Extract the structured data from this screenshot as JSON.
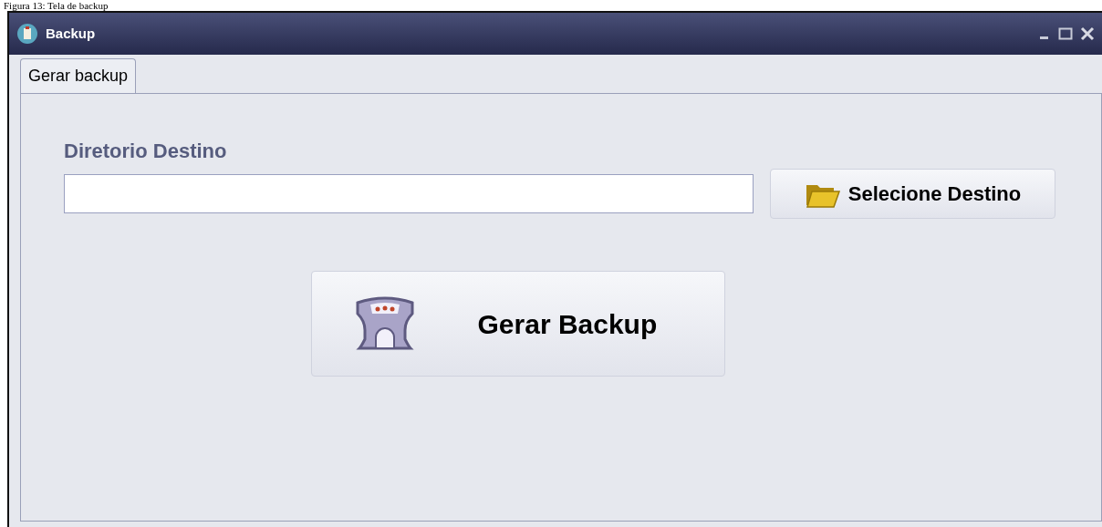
{
  "caption": "Figura 13: Tela de backup",
  "window": {
    "title": "Backup"
  },
  "tabs": [
    {
      "label": "Gerar backup",
      "selected": true
    }
  ],
  "destination": {
    "label": "Diretorio Destino"
  },
  "buttons": {
    "select": "Selecione Destino",
    "generate": "Gerar Backup"
  }
}
